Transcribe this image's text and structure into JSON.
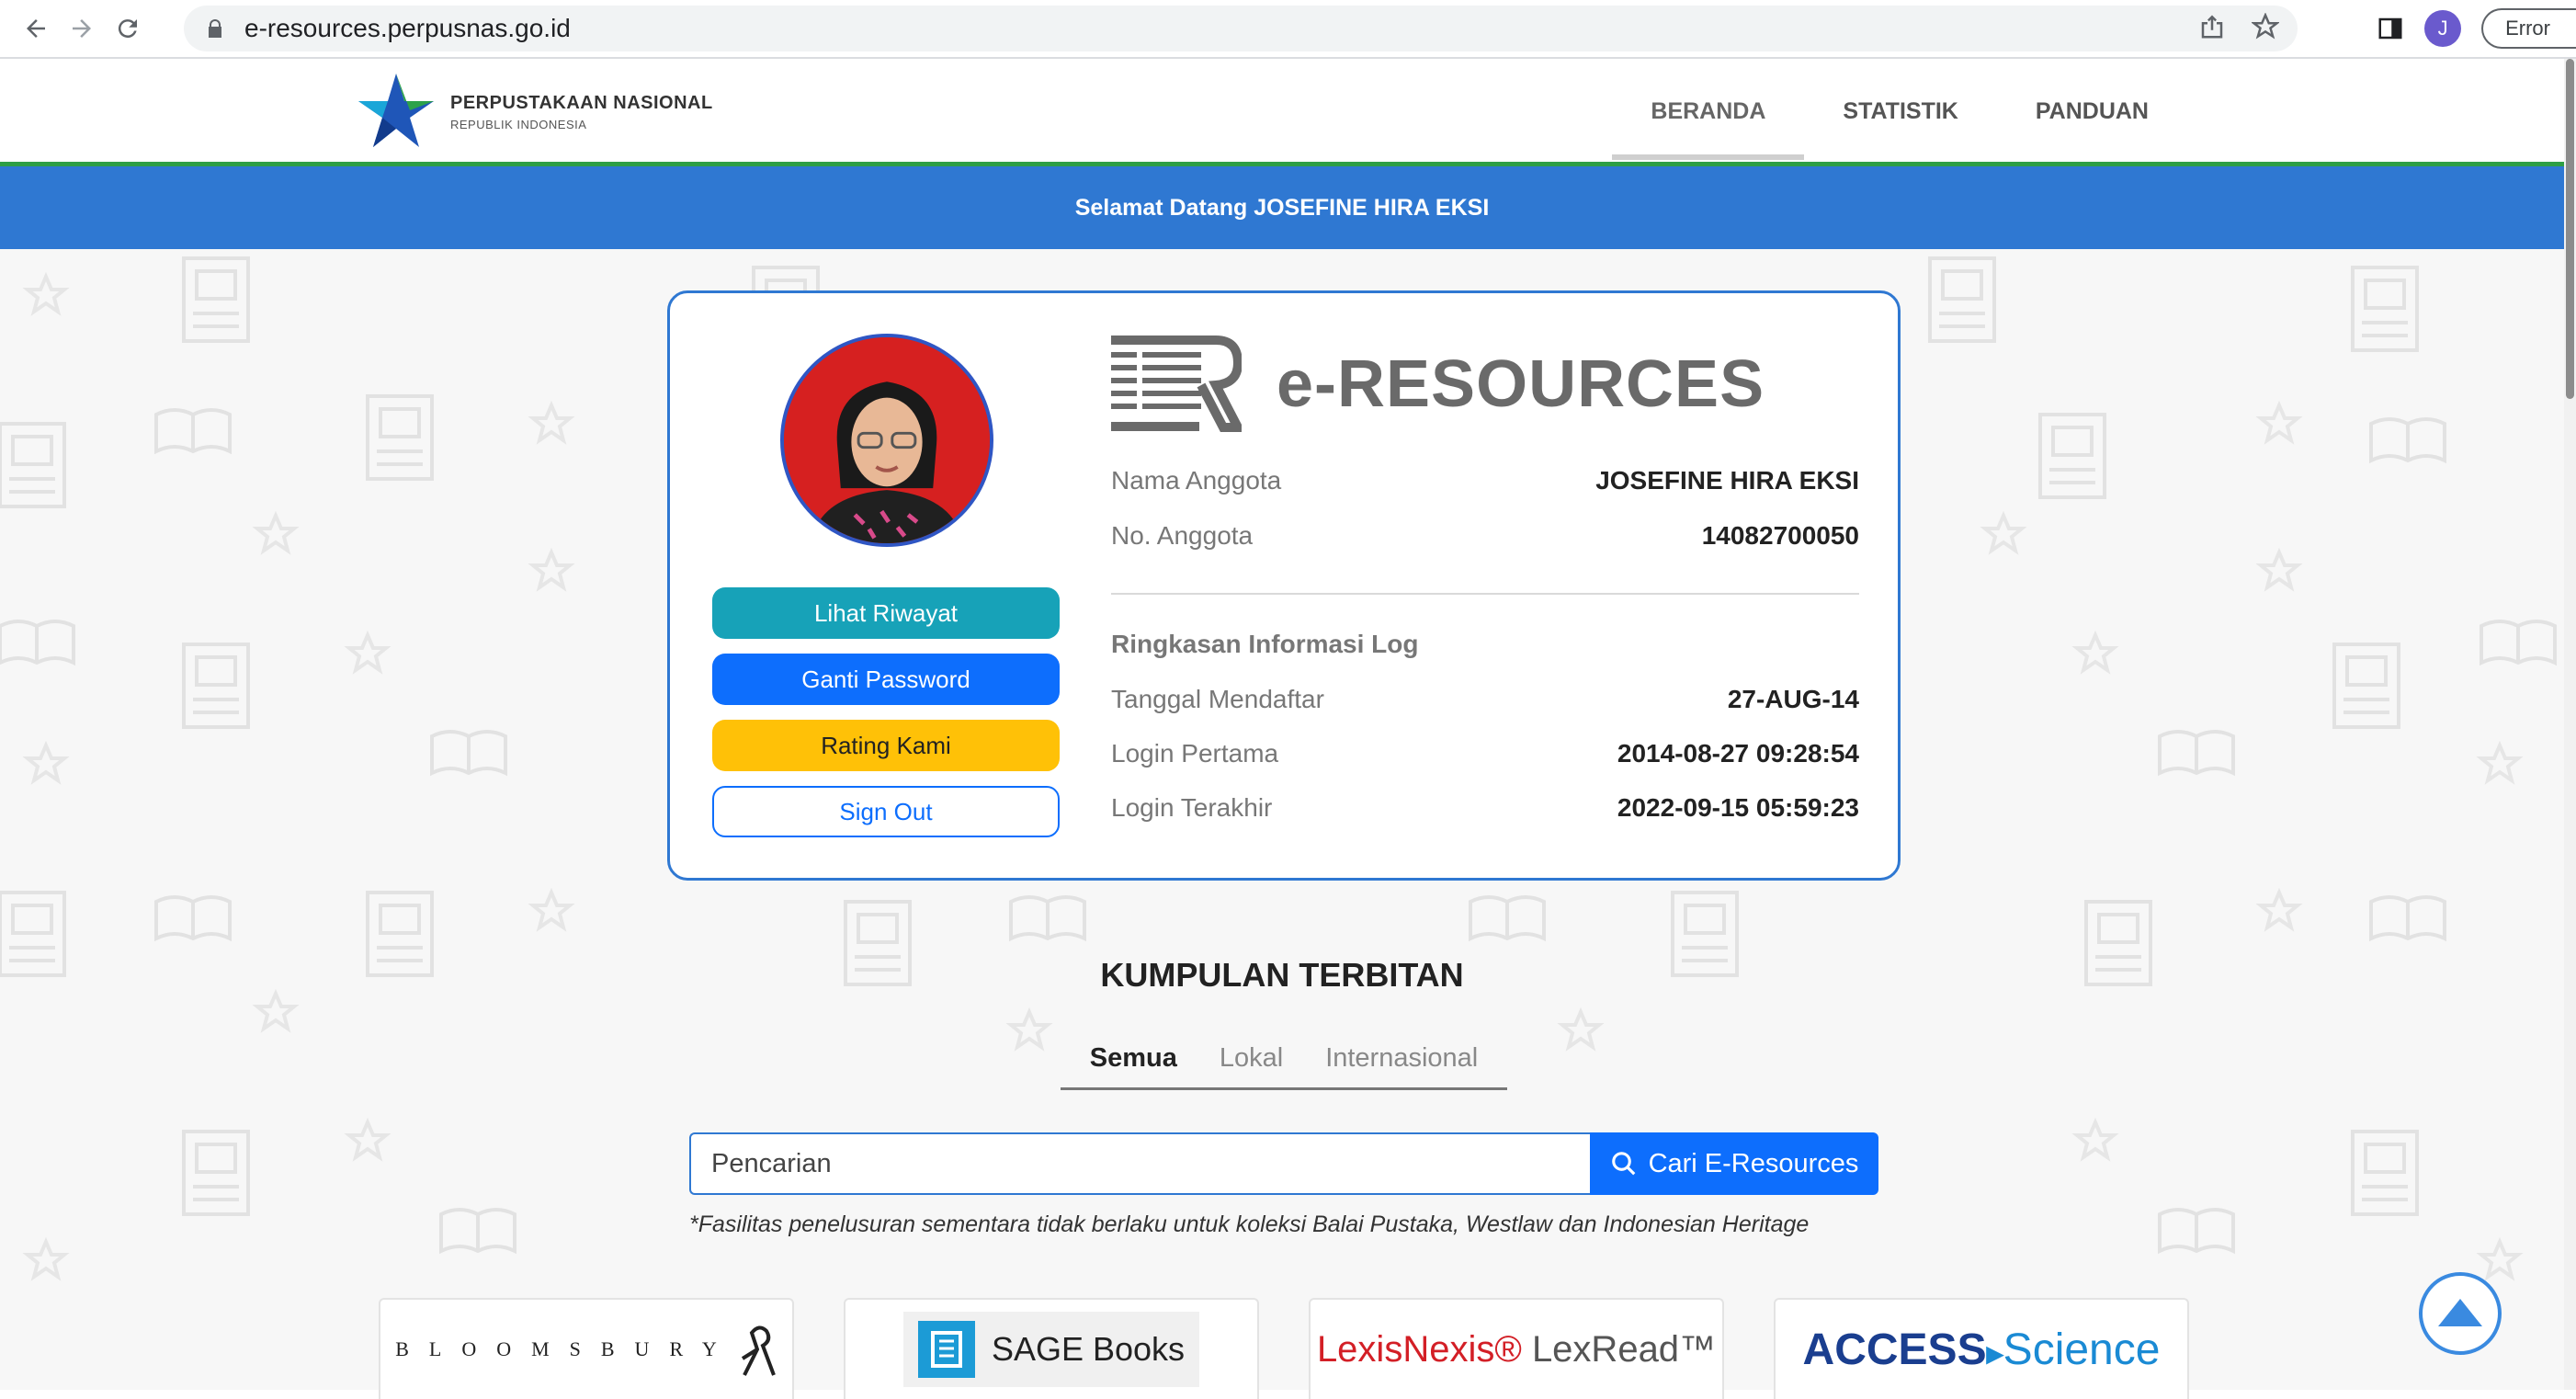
{
  "browser": {
    "url": "e-resources.perpusnas.go.id",
    "profile_initial": "J",
    "error_label": "Error"
  },
  "header": {
    "logo_title": "PERPUSTAKAAN NASIONAL",
    "logo_subtitle": "REPUBLIK INDONESIA",
    "nav": [
      {
        "label": "BERANDA",
        "active": true
      },
      {
        "label": "STATISTIK",
        "active": false
      },
      {
        "label": "PANDUAN",
        "active": false
      }
    ]
  },
  "welcome": "Selamat Datang JOSEFINE HIRA EKSI",
  "profile": {
    "brand": "e-RESOURCES",
    "buttons": {
      "history": "Lihat Riwayat",
      "password": "Ganti Password",
      "rating": "Rating Kami",
      "signout": "Sign Out"
    },
    "member_name_label": "Nama Anggota",
    "member_name": "JOSEFINE HIRA EKSI",
    "member_no_label": "No. Anggota",
    "member_no": "14082700050",
    "log_title": "Ringkasan Informasi Log",
    "registered_label": "Tanggal Mendaftar",
    "registered": "27-AUG-14",
    "first_login_label": "Login Pertama",
    "first_login": "2014-08-27 09:28:54",
    "last_login_label": "Login Terakhir",
    "last_login": "2022-09-15 05:59:23"
  },
  "collection": {
    "title": "KUMPULAN TERBITAN",
    "tabs": [
      {
        "label": "Semua",
        "active": true
      },
      {
        "label": "Lokal",
        "active": false
      },
      {
        "label": "Internasional",
        "active": false
      }
    ],
    "search_placeholder": "Pencarian",
    "search_button": "Cari E-Resources",
    "note": "*Fasilitas penelusuran sementara tidak berlaku untuk koleksi Balai Pustaka, Westlaw dan Indonesian Heritage",
    "publishers": {
      "bloomsbury": "BLOOMSBURY",
      "sage": "SAGE Books",
      "lexis": "LexisNexis®",
      "lexread": "LexRead™",
      "access": "ACCESS",
      "science": "Science"
    }
  },
  "colors": {
    "primary": "#0d6efd",
    "welcome_bar": "#2f78d2",
    "info_button": "#17a2b8",
    "warning_button": "#ffc107",
    "header_green": "#2e9e45"
  }
}
